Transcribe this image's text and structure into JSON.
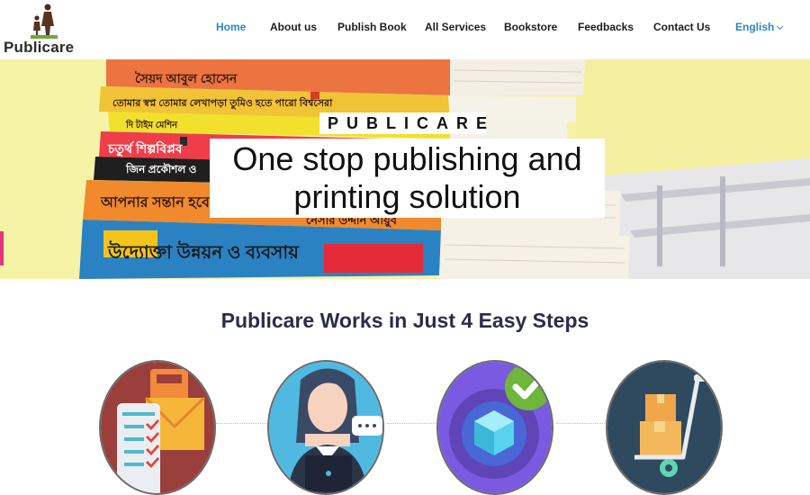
{
  "logo": {
    "text": "Publicare"
  },
  "nav": {
    "home": "Home",
    "about": "About us",
    "publish": "Publish Book",
    "services": "All Services",
    "bookstore": "Bookstore",
    "feedbacks": "Feedbacks",
    "contact": "Contact Us",
    "language": "English"
  },
  "hero": {
    "brand": "PUBLICARE",
    "tagline_line1": "One stop publishing and",
    "tagline_line2": "printing solution",
    "book_spines": [
      "সৈয়দ আবুল হোসেন",
      "তোমার স্বপ্ন তোমার লেখাপড়া তুমিও হতে পারো বিশ্বসেরা",
      "দি টাইম মেশিন",
      "চতুর্থ শিল্পবিপ্লব",
      "জিন প্রকৌশল ও",
      "আপনার সন্তান হবে",
      "নেসার উদ্দীন আয়ুব",
      "উদ্যোক্তা উন্নয়ন ও ব্যবসায়"
    ]
  },
  "steps": {
    "title": "Publicare Works in Just 4 Easy Steps",
    "icons": [
      "form-checklist-icon",
      "support-agent-icon",
      "gear-check-icon",
      "delivery-trolley-icon"
    ]
  },
  "colors": {
    "accent": "#2e86c1",
    "hero_bg": "#f6f2a6",
    "side_accent": "#e5357f",
    "title_text": "#2c2c4a"
  }
}
